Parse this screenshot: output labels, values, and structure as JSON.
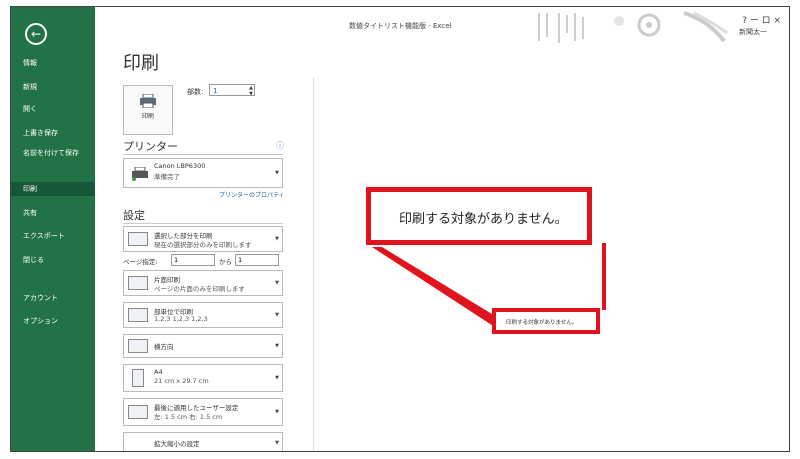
{
  "window": {
    "title": "数値タイトリスト機能版 - Excel",
    "controls": "? ー ロ ×",
    "user": "新聞太一"
  },
  "sidebar": {
    "back_icon": "arrow-left-icon",
    "items": [
      {
        "label": "情報"
      },
      {
        "label": "新規"
      },
      {
        "label": "開く"
      },
      {
        "label": "上書き保存"
      },
      {
        "label": "名前を付けて保存"
      },
      {
        "label": "印刷"
      },
      {
        "label": "共有"
      },
      {
        "label": "エクスポート"
      },
      {
        "label": "閉じる"
      },
      {
        "label": "アカウント"
      },
      {
        "label": "オプション"
      }
    ],
    "active": "印刷",
    "colors": {
      "background": "#217346",
      "active": "#16573a"
    }
  },
  "print": {
    "title": "印刷",
    "button_label": "印刷",
    "copies_label": "部数:",
    "copies_value": "1"
  },
  "printer": {
    "heading": "プリンター",
    "name": "Canon LBP6300",
    "status": "準備完了",
    "properties_link": "プリンターのプロパティ"
  },
  "settings": {
    "heading": "設定",
    "scope": {
      "line1": "選択した部分を印刷",
      "line2": "現在の選択部分のみを印刷します"
    },
    "pages_label": "ページ指定:",
    "pages_from": "1",
    "pages_to_label": "から",
    "pages_to": "1",
    "sides": {
      "line1": "片面印刷",
      "line2": "ページの片面のみを印刷します"
    },
    "collate": {
      "line1": "部単位で印刷",
      "line2": "1,2,3  1,2,3  1,2,3"
    },
    "orientation": {
      "line1": "横方向"
    },
    "paper": {
      "line1": "A4",
      "line2": "21 cm x 29.7 cm"
    },
    "margins": {
      "line1": "最後に適用したユーザー設定",
      "line2": "左: 1.5 cm  右: 1.5 cm"
    },
    "scaling": {
      "line1": "拡大縮小の設定"
    }
  },
  "preview": {
    "message_large": "印刷する対象がありません。",
    "message_small": "印刷する対象がありません。",
    "highlight_color": "#e0141e"
  }
}
